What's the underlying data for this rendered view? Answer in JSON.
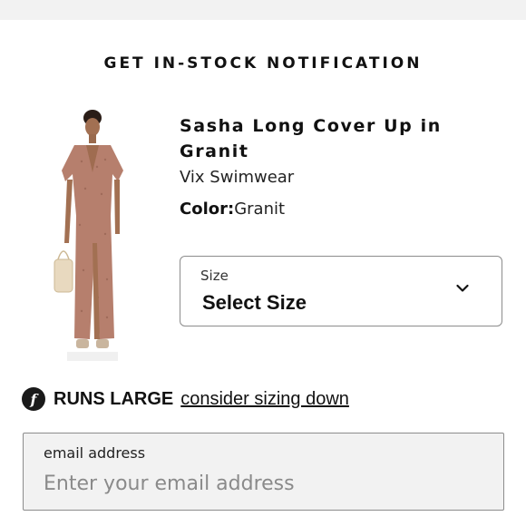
{
  "modal": {
    "title": "GET IN-STOCK NOTIFICATION"
  },
  "product": {
    "name": "Sasha Long Cover Up in Granit",
    "brand": "Vix Swimwear",
    "color_label": "Color:",
    "color_value": "Granit",
    "image_icon": "product-photo"
  },
  "size_select": {
    "label": "Size",
    "value": "Select Size",
    "icon": "chevron-down-icon"
  },
  "fit_note": {
    "icon": "fit-f-icon",
    "icon_glyph": "f",
    "label": "RUNS LARGE",
    "link_text": "consider sizing down"
  },
  "email": {
    "label": "email address",
    "value": "",
    "placeholder": "Enter your email address"
  },
  "colors": {
    "dress": "#b67f6d",
    "page_bg": "#ffffff",
    "strip_bg": "#f2f2f2",
    "field_bg": "#f2f2f2",
    "border": "#8c8c8c"
  }
}
